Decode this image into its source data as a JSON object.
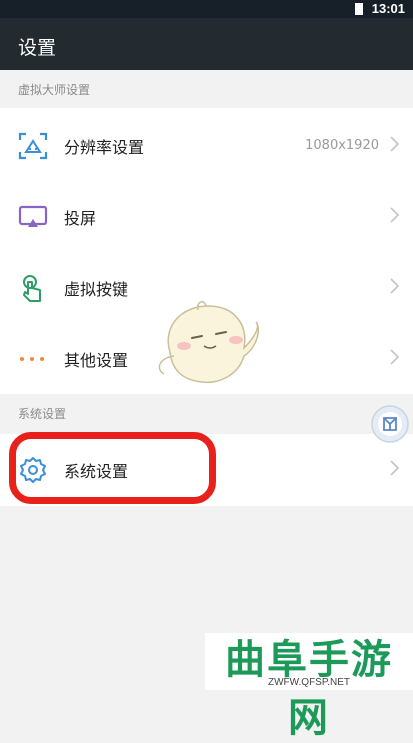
{
  "status_bar": {
    "time": "13:01"
  },
  "app_bar": {
    "title": "设置"
  },
  "sections": [
    {
      "header": "虚拟大师设置",
      "items": [
        {
          "label": "分辨率设置",
          "value": "1080x1920",
          "icon": "resolution-icon"
        },
        {
          "label": "投屏",
          "value": "",
          "icon": "screen-cast-icon"
        },
        {
          "label": "虚拟按键",
          "value": "",
          "icon": "touch-key-icon"
        },
        {
          "label": "其他设置",
          "value": "",
          "icon": "more-dots-icon"
        }
      ]
    },
    {
      "header": "系统设置",
      "items": [
        {
          "label": "系统设置",
          "value": "",
          "icon": "gear-icon"
        }
      ]
    }
  ],
  "colors": {
    "accent": "#3a8fd6",
    "cast_purple": "#8a63c9",
    "touch_green": "#2e9d6a",
    "dots_orange": "#f08a3a",
    "highlight_red": "#e8211b"
  },
  "watermark": {
    "title": "曲阜手游网",
    "url": "ZWFW.QFSP.NET"
  }
}
